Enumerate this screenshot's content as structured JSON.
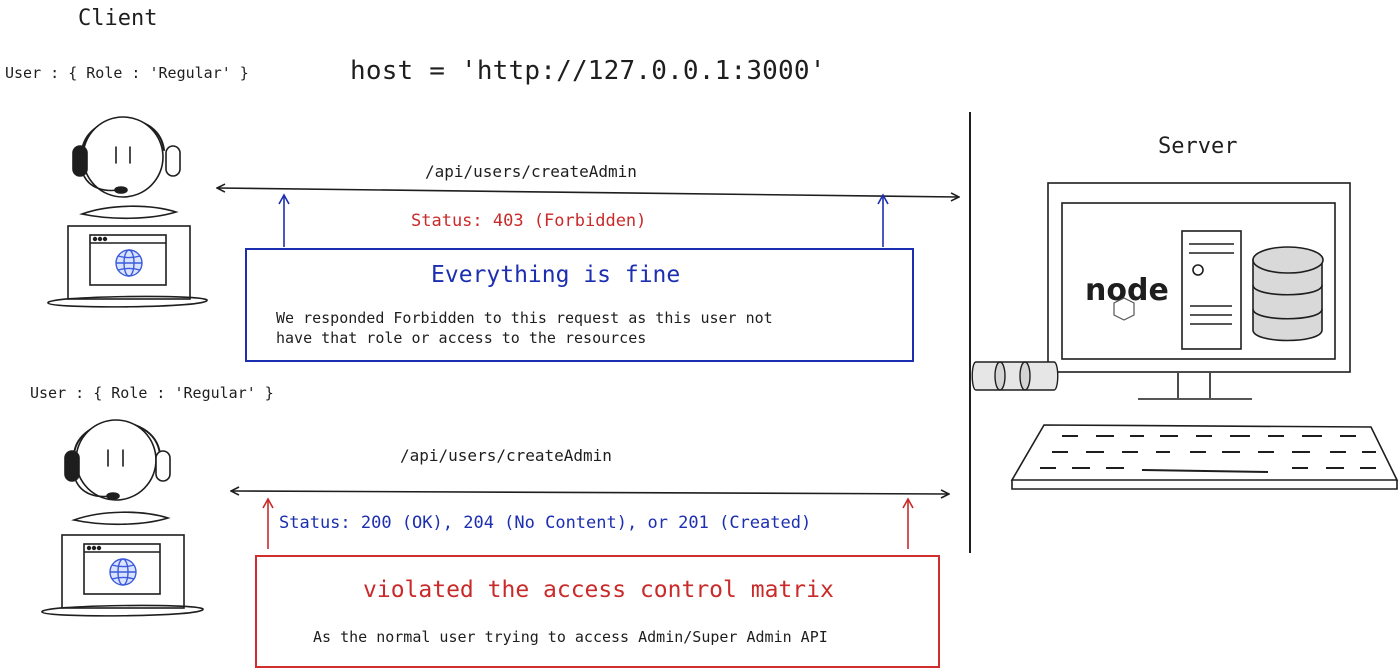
{
  "client": {
    "title": "Client",
    "host": "host = 'http://127.0.0.1:3000'"
  },
  "server": {
    "title": "Server"
  },
  "top": {
    "user_label": "User :  { Role : 'Regular' }",
    "endpoint": "/api/users/createAdmin",
    "status": "Status: 403 (Forbidden)",
    "box_heading": "Everything is fine",
    "box_body": "We responded Forbidden to this request as this user not\nhave that role or access to the resources"
  },
  "bottom": {
    "user_label": "User :  { Role : 'Regular' }",
    "endpoint": "/api/users/createAdmin",
    "status": "Status: 200 (OK), 204 (No Content), or 201 (Created)",
    "box_heading": "violated the access control matrix",
    "box_body": "As the normal user trying to access Admin/Super Admin API"
  },
  "logo_text": "node",
  "colors": {
    "ink": "#1e1e1e",
    "blue": "#1c2fb0",
    "red": "#c92a2a",
    "globe": "#3b5bdb"
  },
  "icons": [
    "user-with-headset-icon",
    "laptop-icon",
    "globe-icon",
    "desktop-computer-icon",
    "server-tower-icon",
    "database-icon",
    "nodejs-logo-icon",
    "keyboard-icon",
    "cable-icon"
  ]
}
